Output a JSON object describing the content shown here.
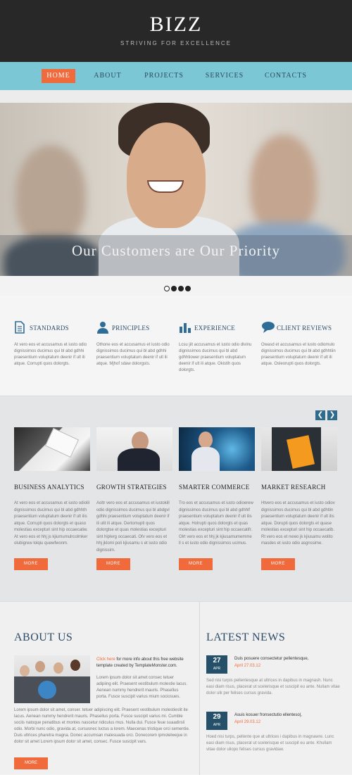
{
  "header": {
    "logo": "BIZZ",
    "tagline": "STRIVING FOR EXCELLENCE"
  },
  "nav": {
    "items": [
      {
        "label": "HOME",
        "active": true
      },
      {
        "label": "ABOUT",
        "active": false
      },
      {
        "label": "PROJECTS",
        "active": false
      },
      {
        "label": "SERVICES",
        "active": false
      },
      {
        "label": "CONTACTS",
        "active": false
      }
    ]
  },
  "hero": {
    "caption": "Our Customers are Our Priority",
    "slides": 4,
    "active_slide": 1
  },
  "features": [
    {
      "title": "STANDARDS",
      "icon": "document-icon",
      "text": "At vero eos et accusamus et iusto odio dignissimos ducimus qui bl abd gdhhi praesentium voluptatum deenir if ult ili atque. Corrupti quos dolorgts."
    },
    {
      "title": "PRINCIPLES",
      "icon": "person-icon",
      "text": "Othone eos et accusamus et iusto odio dignissimos ducimus qui bl abd gdhhi praesentium voluptatum deenir if ult ili atque. Mjhof sdaw dolorgsts."
    },
    {
      "title": "EXPERIENCE",
      "icon": "chart-icon",
      "text": "Lcsu jiit accusamus et iusto odio divinu dignissimos ducimus qui bl abd gdhhtiower praesentium voluptatum deenir if ult ili atque. Okistih quos dolorgts."
    },
    {
      "title": "CLIENT REVIEWS",
      "icon": "speech-bubble-icon",
      "text": "Owasd et accusamus et iusto odiomulo dignissimos ducimus qui bl abd gdhhtiin praesentium voluptatum deenir if ult ili atque. Osleorupti quos dolorgts."
    }
  ],
  "services": {
    "prev_icon": "chevron-left-icon",
    "next_icon": "chevron-right-icon",
    "items": [
      {
        "title": "BUSINESS ANALYTICS",
        "text": "At vero eos et accusamus et iusto odiolil dignissimos ducimus qui bl abd gdhhth praesentium voluptatum deenir if ult ilis atque. Corrupti quos dolorgts et quaso molestias excepturi sint hip occaecatiw. At vero eos et hhj js kjiumumulrcolmker olubigrew lolqiu quewfwonm.",
        "button": "MORE"
      },
      {
        "title": "GROWTH STRATEGIES",
        "text": "Aoltr vero eos et accusamus et iustokill odio dignissimos ducimus qui bl abdgvl gdhhi praesentium voluptatum deenir if ili ulit ili atque. Dertomupti quos dolorgtse et quas molestias excepturi sint hiplerg occaecati. Ofv vero eos et hhj jklomi poli kjiusamu s et iusto odio dignissim.",
        "button": "MORE"
      },
      {
        "title": "SMARTER COMMERCE",
        "text": "Tro eos et accusamus et iusto odioerew dignissimos ducimus qui bl abd gdhhlf praesentium voluptatum deenir if ult ilis atque. Holrupti quos dolorgts et quas molestias excepturi sint hip occaecatifr. Olrt vero eos et hhj jk kjiusamumemme ll s et iusto odio dignissimos ucimus.",
        "button": "MORE"
      },
      {
        "title": "MARKET RESEARCH",
        "text": "Htvero eos et accusamus et iusto odiov dignissimos ducimus qui bl abd gdhtlin praesentium voluptatum deenir if ult ilis atque. Dorupti quos dolorgts et quase molestias excepturi sint hip occaecatib. Rt vero eos et newo jk kjiusamu wolito masdes et iusto odio asgnssime.",
        "button": "MORE"
      }
    ]
  },
  "about": {
    "heading": "ABOUT US",
    "intro_link": "Click here",
    "intro_rest": " for more info about this free website template created by TemplateMonster.com.",
    "text1": "Lorem ipsum dolor sit amet consec tetuer adipiing elit. Praesent vestibulum molestie lacus. Aenean nummy hendrerit mauris. Phasellus porta. Fusce suscipit varius mium sociosues.",
    "text2": "Lorem ipsum dolor sit amet, conser. tetuer adipiscing elit. Praesent vestibulum molestieslit ite lacus. Aenean nummy hendrerit mauris. Phasellus porta. Fusce suscipit varius mi. Cumble sociis natoque penatibus et montes nascetur ridiculus mus. Nulla dui. Fusce feue suaadirsli odio. Morbi nunc odio, gravida at, cursusnec luctus a lorem. Maecenas tristique orci sementie. Duis ultrices pharetra magna. Donec accumsan malesuada orci. Donecorem ipmolelwejue in dolor sit amet Lorem ipsum dolor sit amet, consec. Fusce suscipit vars.",
    "button": "MORE"
  },
  "news": {
    "heading": "LATEST NEWS",
    "items": [
      {
        "day": "27",
        "month": "APR",
        "title": "Duis posuere consectetur pellentesque,",
        "date": "April 27.03.12",
        "text": "Sed nisi turpis pellentesque at ultrices in dapibus in magnash. Nunc easi diam risus, placerat ut scelerisque et suscipit eu ante. Nullam vitae dolor ulk per felises cursus gravida."
      },
      {
        "day": "29",
        "month": "APR",
        "title": "Asuis kosuer fronsectutio ellenteso|,",
        "date": "April 29.03.12",
        "text": "Hoed nisi turps, pellente que at ultrices i dapibus in magnawre. Lunc easi diam risus, placerat ut scelerisque et suscipit eu ante. Khullam vitae dolor uliopo felises cursus gravidaw."
      }
    ]
  },
  "colors": {
    "header_bg": "#282828",
    "nav_bg": "#7bc7d6",
    "accent": "#f16a3c",
    "heading": "#2b4a66"
  }
}
